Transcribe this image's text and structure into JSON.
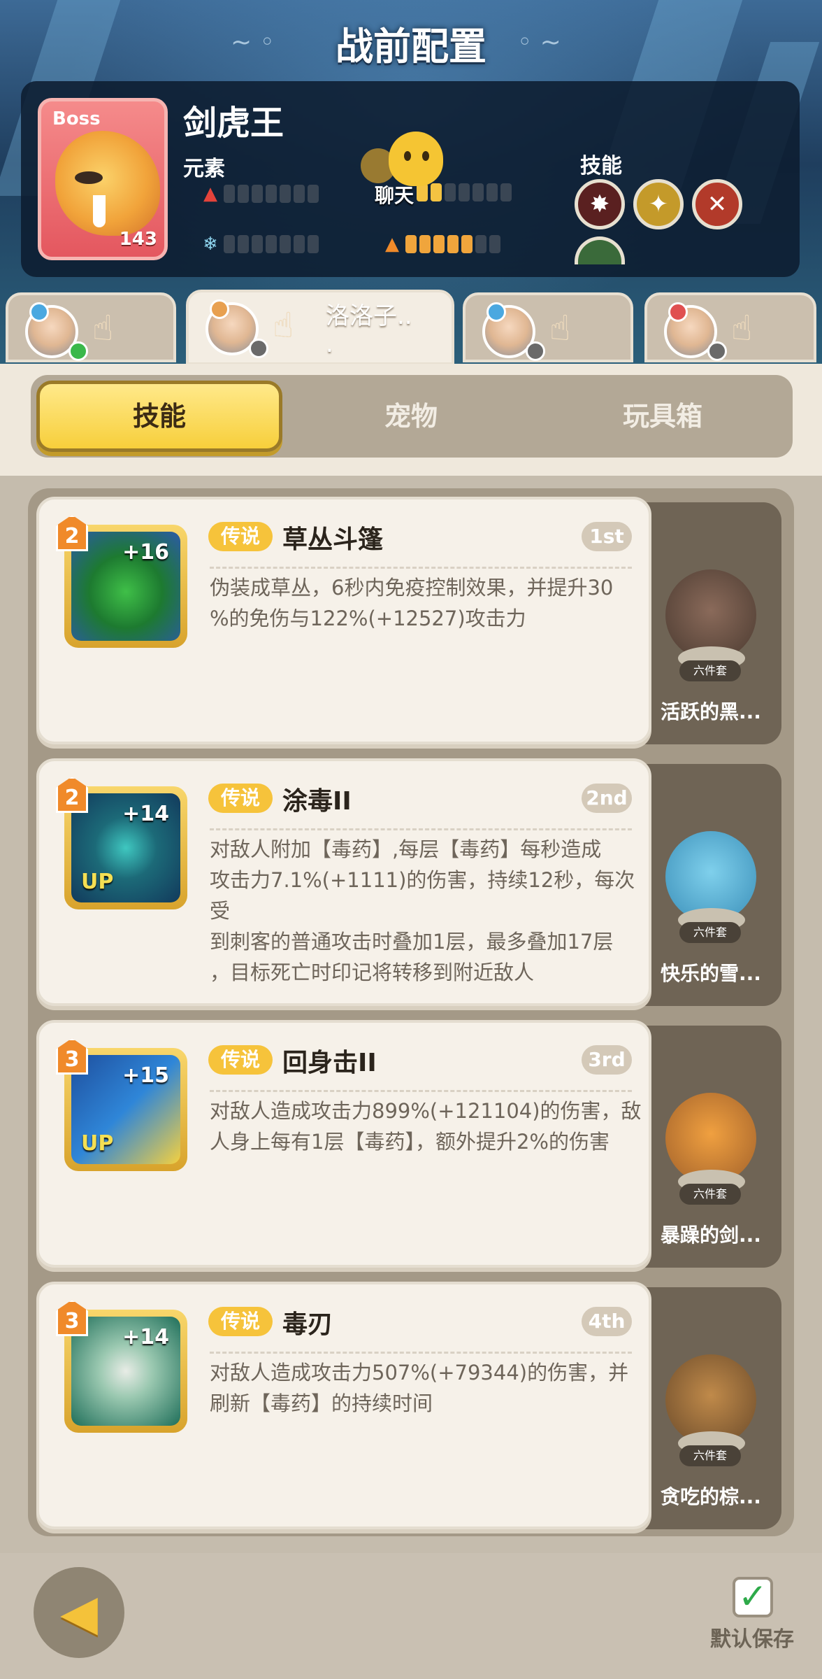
{
  "header": {
    "title": "战前配置"
  },
  "boss": {
    "tag": "Boss",
    "name": "剑虎王",
    "level": "143",
    "element_label": "元素",
    "skills_label": "技能",
    "chat_label": "聊天"
  },
  "heroes": [
    {
      "name": "",
      "badge_color": "#4aa8e0",
      "active": false
    },
    {
      "name": "洛洛子..\n.",
      "badge_color": "#e8a050",
      "active": true
    },
    {
      "name": "",
      "badge_color": "#4aa8e0",
      "active": false
    },
    {
      "name": "",
      "badge_color": "#e05050",
      "active": false
    }
  ],
  "tabs": [
    "技能",
    "宠物",
    "玩具箱"
  ],
  "skills": [
    {
      "level": "2",
      "plus": "+16",
      "up": "",
      "rarity": "传说",
      "name": "草丛斗篷",
      "rank": "1st",
      "desc": "伪装成草丛，6秒内免疫控制效果，并提升30\n%的免伤与122%(+12527)攻击力",
      "icon_color": "#2c5aa8",
      "pet": {
        "set": "六件套",
        "name": "活跃的黑..."
      }
    },
    {
      "level": "2",
      "plus": "+14",
      "up": "UP",
      "rarity": "传说",
      "name": "涂毒II",
      "rank": "2nd",
      "desc": "对敌人附加【毒药】,每层【毒药】每秒造成\n攻击力7.1%(+1111)的伤害，持续12秒，每次受\n到刺客的普通攻击时叠加1层，最多叠加17层\n，目标死亡时印记将转移到附近敌人",
      "icon_color": "#123a5c",
      "pet": {
        "set": "六件套",
        "name": "快乐的雪..."
      }
    },
    {
      "level": "3",
      "plus": "+15",
      "up": "UP",
      "rarity": "传说",
      "name": "回身击II",
      "rank": "3rd",
      "desc": "对敌人造成攻击力899%(+121104)的伤害，敌\n人身上每有1层【毒药】，额外提升2%的伤害",
      "icon_color": "#1e4f9e",
      "pet": {
        "set": "六件套",
        "name": "暴躁的剑..."
      }
    },
    {
      "level": "3",
      "plus": "+14",
      "up": "",
      "rarity": "传说",
      "name": "毒刃",
      "rank": "4th",
      "desc": "对敌人造成攻击力507%(+79344)的伤害，并\n刷新【毒药】的持续时间",
      "icon_color": "#1f6f5a",
      "pet": {
        "set": "六件套",
        "name": "贪吃的棕..."
      }
    }
  ],
  "footer": {
    "save_label": "默认保存",
    "check_glyph": "✓"
  },
  "colors": {
    "accent": "#f7cf3b",
    "highlight_green": "#3aa84a"
  }
}
